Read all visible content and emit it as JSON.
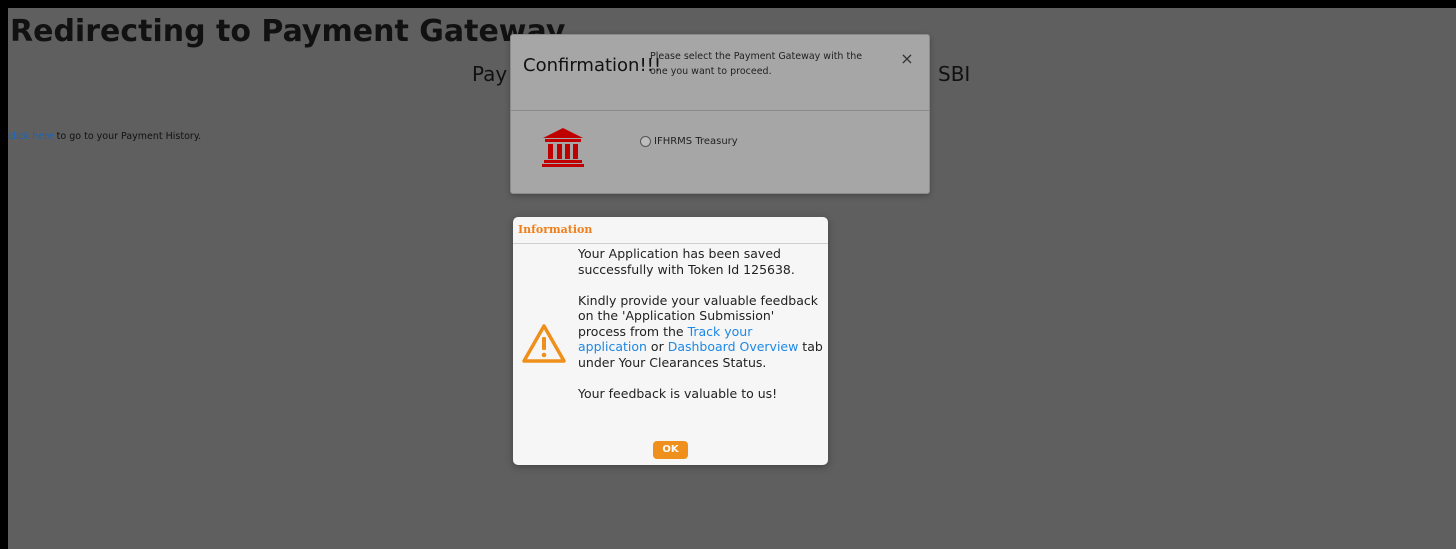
{
  "page": {
    "title": "Redirecting to Payment Gateway",
    "subtitle_left": "Pay",
    "subtitle_right": "SBI",
    "history_link": "click here",
    "history_text": " to go to your Payment History."
  },
  "confirm_modal": {
    "title": "Confirmation!!!",
    "message": "Please select the Payment Gateway with the one you want to proceed.",
    "close": "×",
    "option_label": "IFHRMS Treasury",
    "icon": "bank-icon",
    "icon_color": "#c00000"
  },
  "info_dialog": {
    "title": "Information",
    "title_color": "#f07f1a",
    "icon": "warning-icon",
    "line1": "Your Application has been saved successfully with Token Id 125638.",
    "line2_a": "Kindly provide your valuable feedback on the 'Application Submission' process from the ",
    "link_track": "Track your application",
    "line2_or": " or ",
    "link_dashboard": "Dashboard Overview",
    "line2_b": " tab under Your Clearances Status.",
    "line3": "Your feedback is valuable to us!",
    "ok_label": "OK",
    "accent": "#f0901c"
  }
}
